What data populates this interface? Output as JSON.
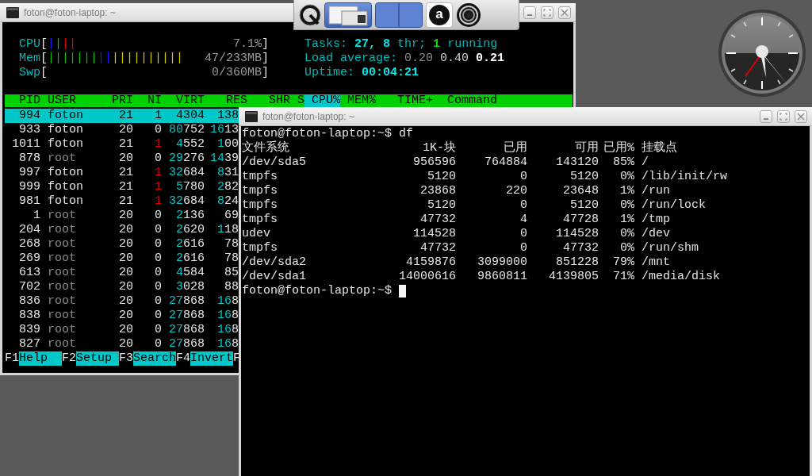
{
  "htop_window": {
    "title": "foton@foton-laptop: ~",
    "meters": [
      {
        "label": "CPU",
        "open": "[",
        "segments": [
          {
            "text": "|",
            "color": "#1a1aff"
          },
          {
            "text": "|",
            "color": "#00c000"
          },
          {
            "text": "||",
            "color": "#e00000"
          }
        ],
        "reading": "7.1%",
        "close": "]"
      },
      {
        "label": "Mem",
        "open": "[",
        "segments": [
          {
            "text": "|||||||",
            "color": "#00c000"
          },
          {
            "text": "||",
            "color": "#1a1aff"
          },
          {
            "text": "||||||||||",
            "color": "#d8c800"
          }
        ],
        "reading": "47/233MB",
        "close": "]"
      },
      {
        "label": "Swp",
        "open": "[",
        "reading": "0/360MB",
        "close": "]"
      }
    ],
    "stats": [
      {
        "parts": [
          {
            "text": "Tasks:",
            "kind": "label"
          },
          {
            "text": "27,",
            "kind": "value"
          },
          {
            "text": "8",
            "kind": "value"
          },
          {
            "text": "thr;",
            "kind": "label"
          },
          {
            "text": "1",
            "kind": "running"
          },
          {
            "text": "running",
            "kind": "label"
          }
        ]
      },
      {
        "parts": [
          {
            "text": "Load average:",
            "kind": "label"
          },
          {
            "text": "0.20",
            "kind": "load_low"
          },
          {
            "text": "0.40",
            "kind": "load_mid"
          },
          {
            "text": "0.21",
            "kind": "load_high"
          }
        ]
      },
      {
        "parts": [
          {
            "text": "Uptime:",
            "kind": "label"
          },
          {
            "text": "00:04:21",
            "kind": "value"
          }
        ]
      }
    ],
    "columns": [
      {
        "label": "PID",
        "selected": false
      },
      {
        "label": "USER",
        "selected": false
      },
      {
        "label": "PRI",
        "selected": false
      },
      {
        "label": "NI",
        "selected": false
      },
      {
        "label": "VIRT",
        "selected": false
      },
      {
        "label": "RES",
        "selected": false
      },
      {
        "label": "SHR",
        "selected": false
      },
      {
        "label": "S",
        "selected": false
      },
      {
        "label": "CPU%",
        "selected": true
      },
      {
        "label": "MEM%",
        "selected": false
      },
      {
        "label": "TIME+",
        "selected": false
      },
      {
        "label": "Command",
        "selected": false
      }
    ],
    "processes": [
      {
        "pid": "994",
        "user": "foton",
        "pri": "21",
        "ni": "1",
        "virt": "4304",
        "res": "138",
        "selected": true,
        "user_dimmed": false,
        "ni_highlight": false
      },
      {
        "pid": "933",
        "user": "foton",
        "pri": "20",
        "ni": "0",
        "virt": "**80**752",
        "res": "**16**13",
        "selected": false,
        "user_dimmed": false,
        "ni_highlight": false
      },
      {
        "pid": "1011",
        "user": "foton",
        "pri": "21",
        "ni": "1",
        "virt": "**4**552",
        "res": "**1**00",
        "selected": false,
        "user_dimmed": false,
        "ni_highlight": true
      },
      {
        "pid": "878",
        "user": "root",
        "pri": "20",
        "ni": "0",
        "virt": "**29**276",
        "res": "**14**39",
        "selected": false,
        "user_dimmed": true,
        "ni_highlight": false
      },
      {
        "pid": "997",
        "user": "foton",
        "pri": "21",
        "ni": "1",
        "virt": "**32**684",
        "res": "**8**31",
        "selected": false,
        "user_dimmed": false,
        "ni_highlight": true
      },
      {
        "pid": "999",
        "user": "foton",
        "pri": "21",
        "ni": "1",
        "virt": "**5**780",
        "res": "**2**82",
        "selected": false,
        "user_dimmed": false,
        "ni_highlight": true
      },
      {
        "pid": "981",
        "user": "foton",
        "pri": "21",
        "ni": "1",
        "virt": "**32**684",
        "res": "**8**24",
        "selected": false,
        "user_dimmed": false,
        "ni_highlight": true
      },
      {
        "pid": "1",
        "user": "root",
        "pri": "20",
        "ni": "0",
        "virt": "**2**136",
        "res": "69",
        "selected": false,
        "user_dimmed": true,
        "ni_highlight": false
      },
      {
        "pid": "204",
        "user": "root",
        "pri": "20",
        "ni": "0",
        "virt": "**2**620",
        "res": "**1**18",
        "selected": false,
        "user_dimmed": true,
        "ni_highlight": false
      },
      {
        "pid": "268",
        "user": "root",
        "pri": "20",
        "ni": "0",
        "virt": "**2**616",
        "res": "78",
        "selected": false,
        "user_dimmed": true,
        "ni_highlight": false
      },
      {
        "pid": "269",
        "user": "root",
        "pri": "20",
        "ni": "0",
        "virt": "**2**616",
        "res": "78",
        "selected": false,
        "user_dimmed": true,
        "ni_highlight": false
      },
      {
        "pid": "613",
        "user": "root",
        "pri": "20",
        "ni": "0",
        "virt": "**4**584",
        "res": "85",
        "selected": false,
        "user_dimmed": true,
        "ni_highlight": false
      },
      {
        "pid": "702",
        "user": "root",
        "pri": "20",
        "ni": "0",
        "virt": "**3**028",
        "res": "88",
        "selected": false,
        "user_dimmed": true,
        "ni_highlight": false
      },
      {
        "pid": "836",
        "user": "root",
        "pri": "20",
        "ni": "0",
        "virt": "**27**868",
        "res": "**16**8",
        "selected": false,
        "user_dimmed": true,
        "ni_highlight": false
      },
      {
        "pid": "838",
        "user": "root",
        "pri": "20",
        "ni": "0",
        "virt": "**27**868",
        "res": "**16**8",
        "selected": false,
        "user_dimmed": true,
        "ni_highlight": false
      },
      {
        "pid": "839",
        "user": "root",
        "pri": "20",
        "ni": "0",
        "virt": "**27**868",
        "res": "**16**8",
        "selected": false,
        "user_dimmed": true,
        "ni_highlight": false
      },
      {
        "pid": "827",
        "user": "root",
        "pri": "20",
        "ni": "0",
        "virt": "**27**868",
        "res": "**16**8",
        "selected": false,
        "user_dimmed": true,
        "ni_highlight": false
      }
    ],
    "function_keys": [
      {
        "key": "F1",
        "label": "Help"
      },
      {
        "key": "F2",
        "label": "Setup"
      },
      {
        "key": "F3",
        "label": "Search"
      },
      {
        "key": "F4",
        "label": "Invert"
      },
      {
        "key": "F"
      }
    ]
  },
  "panel": {
    "launcher_letter": "a"
  },
  "terminal_window": {
    "title": "foton@foton-laptop: ~",
    "command": "foton@foton-laptop:~$ df",
    "df_columns": [
      "文件系统",
      "1K-块",
      "已用",
      "可用",
      "已用%",
      "挂载点"
    ],
    "df_rows": [
      [
        "/dev/sda5",
        "956596",
        "764884",
        "143120",
        "85%",
        "/"
      ],
      [
        "tmpfs",
        "5120",
        "0",
        "5120",
        "0%",
        "/lib/init/rw"
      ],
      [
        "tmpfs",
        "23868",
        "220",
        "23648",
        "1%",
        "/run"
      ],
      [
        "tmpfs",
        "5120",
        "0",
        "5120",
        "0%",
        "/run/lock"
      ],
      [
        "tmpfs",
        "47732",
        "4",
        "47728",
        "1%",
        "/tmp"
      ],
      [
        "udev",
        "114528",
        "0",
        "114528",
        "0%",
        "/dev"
      ],
      [
        "tmpfs",
        "47732",
        "0",
        "47732",
        "0%",
        "/run/shm"
      ],
      [
        "/dev/sda2",
        "4159876",
        "3099000",
        "851228",
        "79%",
        "/mnt"
      ],
      [
        "/dev/sda1",
        "14000616",
        "9860811",
        "4139805",
        "71%",
        "/media/disk"
      ]
    ],
    "prompt": "foton@foton-laptop:~$"
  }
}
